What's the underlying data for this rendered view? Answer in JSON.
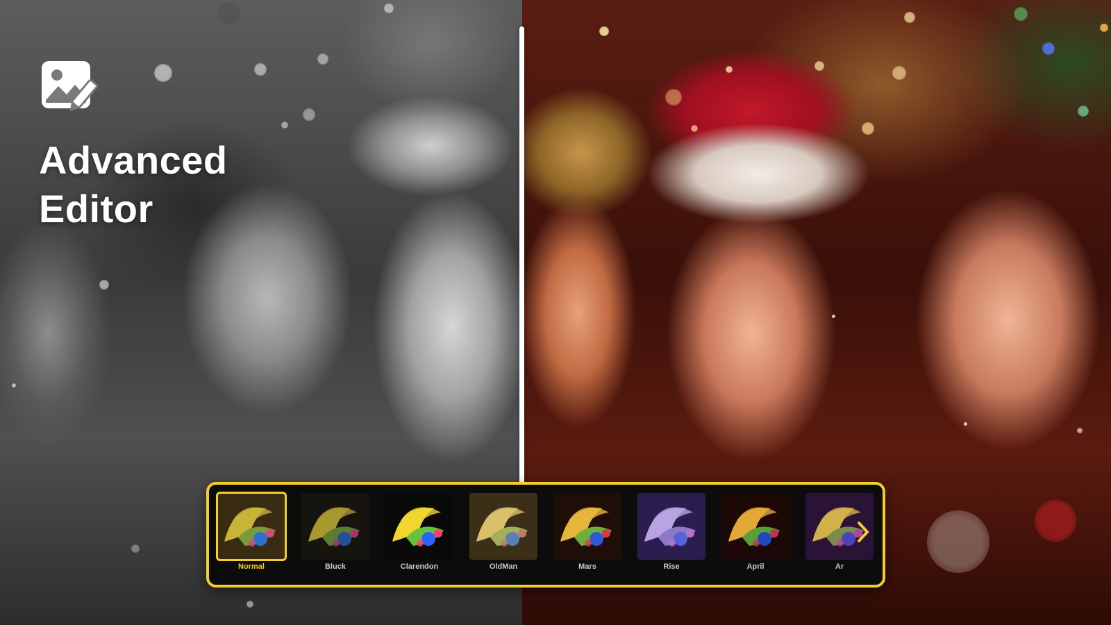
{
  "app": {
    "title_line1": "Advanced",
    "title_line2": "Editor",
    "icon": "image-edit-icon"
  },
  "compare": {
    "left_mode": "grayscale",
    "right_mode": "color"
  },
  "filters": {
    "selected_index": 0,
    "items": [
      {
        "label": "Normal",
        "tone": "normal"
      },
      {
        "label": "Bluck",
        "tone": "dark"
      },
      {
        "label": "Clarendon",
        "tone": "vivid"
      },
      {
        "label": "OldMan",
        "tone": "warm"
      },
      {
        "label": "Mars",
        "tone": "red"
      },
      {
        "label": "Rise",
        "tone": "purple"
      },
      {
        "label": "April",
        "tone": "deep"
      },
      {
        "label": "Ar",
        "tone": "violet"
      }
    ],
    "next_icon": "chevron-right-icon"
  },
  "colors": {
    "accent": "#f3cf2b",
    "strip_bg": "#0c0c0c",
    "divider": "#ffffff"
  }
}
